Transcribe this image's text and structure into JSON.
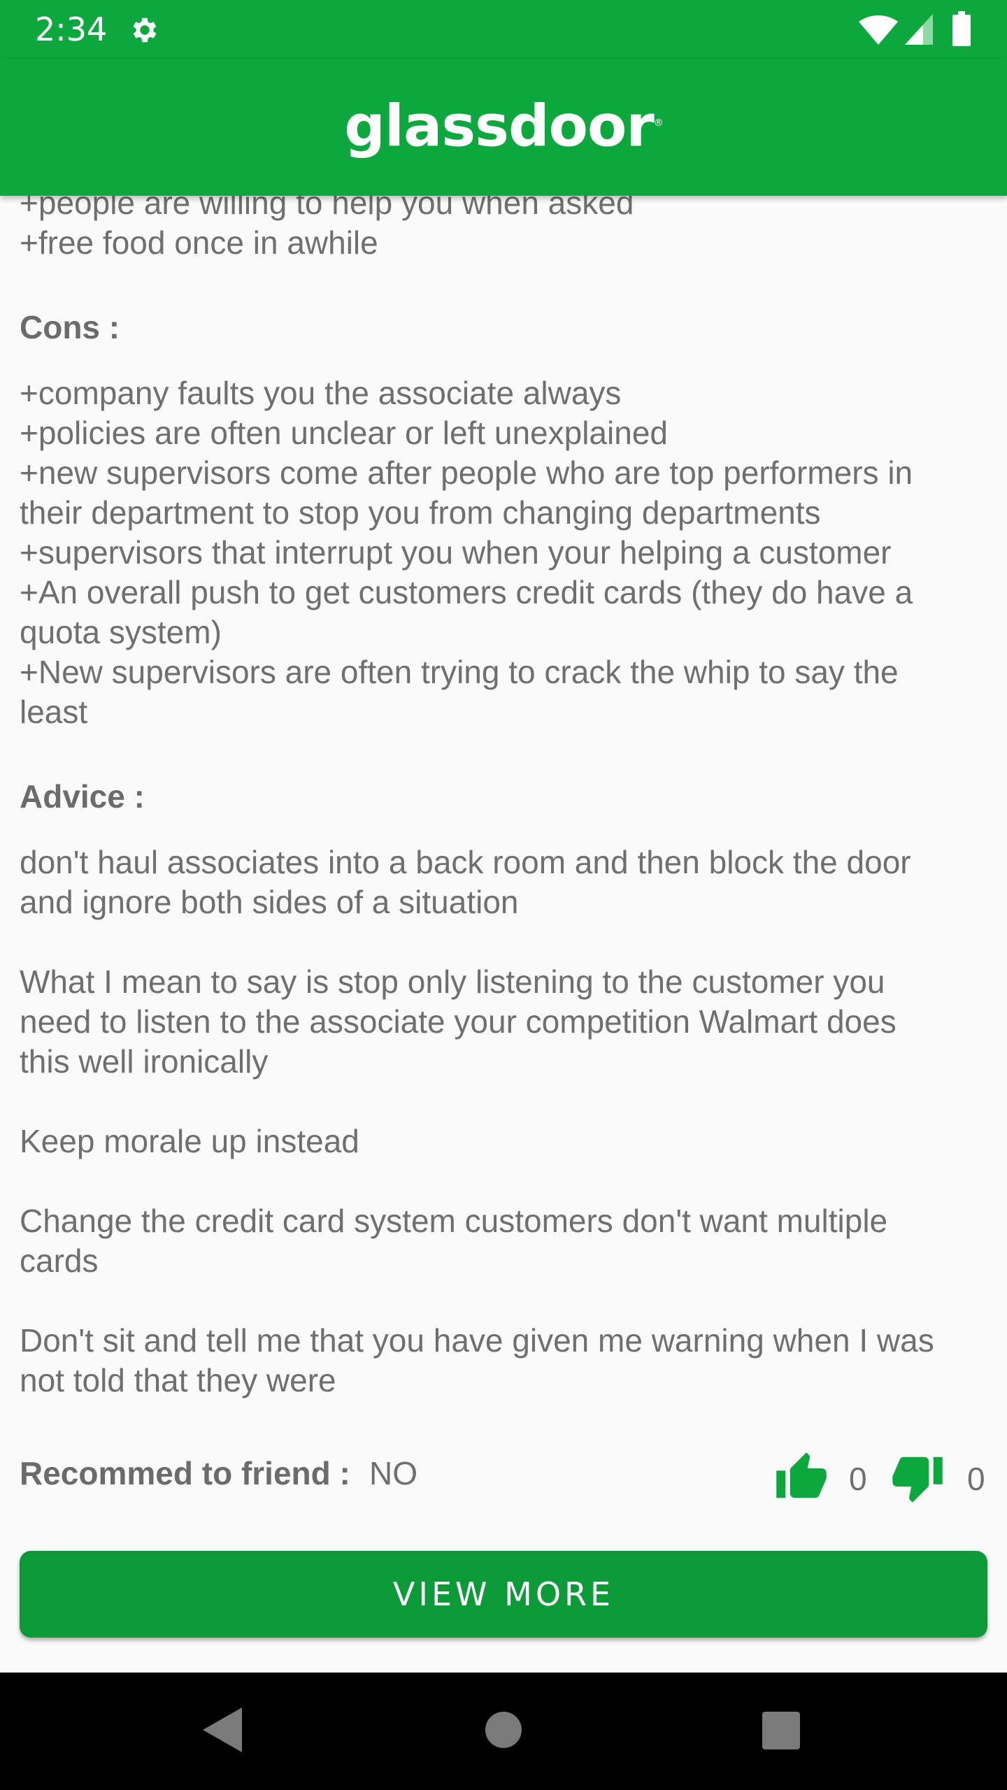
{
  "status_bar": {
    "time": "2:34",
    "icons": [
      "gear-icon",
      "wifi-icon",
      "signal-icon",
      "battery-icon"
    ]
  },
  "app_bar": {
    "logo": "glassdoor",
    "logo_mark": "®",
    "color": "#0da83d"
  },
  "review": {
    "pros_lines": [
      "+people are willing to help you when asked",
      "+free food once in awhile"
    ],
    "cons_heading": "Cons :",
    "cons_lines": [
      "+company faults you the associate always",
      "+policies are often unclear or left unexplained",
      "+new supervisors come after people who are top performers in",
      "their department to stop you from changing departments",
      "+supervisors that interrupt you when your helping a customer",
      "+An overall push to get customers credit cards (they do have a",
      "quota system)",
      "+New supervisors are often trying to crack the whip to say the",
      "least"
    ],
    "advice_heading": "Advice :",
    "advice_paragraphs": [
      [
        "don't haul associates into a back room and then block the door",
        "and ignore both sides of a situation"
      ],
      [
        "What I mean to say is stop only listening to the customer you",
        "need to listen to the associate your competition Walmart does",
        "this well ironically"
      ],
      [
        "Keep morale up instead"
      ],
      [
        "Change the credit card system customers don't want multiple",
        "cards"
      ],
      [
        "Don't sit and tell me that you have given me warning when I was",
        "not told that they were"
      ]
    ],
    "recommend_label": "Recommed to friend :",
    "recommend_value": "NO",
    "helpful_count": "0",
    "not_helpful_count": "0"
  },
  "actions": {
    "view_more_label": "VIEW MORE"
  },
  "nav_bar": {
    "icons": [
      "back-icon",
      "home-icon",
      "recents-icon"
    ]
  }
}
